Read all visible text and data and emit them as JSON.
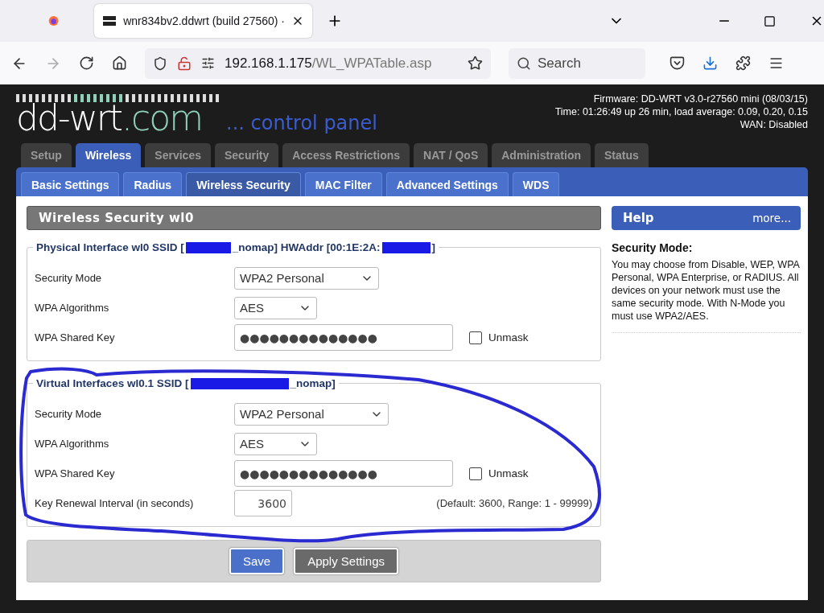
{
  "browser": {
    "tab_title": "wnr834bv2.ddwrt (build 27560) ·",
    "url_host": "192.168.1.175",
    "url_path": "/WL_WPATable.asp",
    "search_placeholder": "Search"
  },
  "header": {
    "logo": "dd-wrt",
    "logo_suffix": ".com",
    "tagline": "... control panel",
    "info": [
      "Firmware: DD-WRT v3.0-r27560 mini (08/03/15)",
      "Time: 01:26:49 up 26 min, load average: 0.09, 0.20, 0.15",
      "WAN: Disabled"
    ]
  },
  "main_tabs": [
    {
      "label": "Setup",
      "selected": false
    },
    {
      "label": "Wireless",
      "selected": true
    },
    {
      "label": "Services",
      "selected": false
    },
    {
      "label": "Security",
      "selected": false
    },
    {
      "label": "Access Restrictions",
      "selected": false
    },
    {
      "label": "NAT / QoS",
      "selected": false
    },
    {
      "label": "Administration",
      "selected": false
    },
    {
      "label": "Status",
      "selected": false
    }
  ],
  "sub_tabs": [
    {
      "label": "Basic Settings",
      "selected": false
    },
    {
      "label": "Radius",
      "selected": false
    },
    {
      "label": "Wireless Security",
      "selected": true
    },
    {
      "label": "MAC Filter",
      "selected": false
    },
    {
      "label": "Advanced Settings",
      "selected": false
    },
    {
      "label": "WDS",
      "selected": false
    }
  ],
  "section_title": "Wireless Security wl0",
  "fieldsets": [
    {
      "legend": [
        {
          "kind": "text",
          "text": "Physical Interface wl0 SSID ["
        },
        {
          "kind": "redacted"
        },
        {
          "kind": "text",
          "text": "_nomap] HWAddr [00:1E:2A:"
        },
        {
          "kind": "redacted"
        },
        {
          "kind": "text",
          "text": "]"
        }
      ],
      "rows": [
        {
          "kind": "select",
          "label": "Security Mode",
          "value": "WPA2 Personal"
        },
        {
          "kind": "select",
          "label": "WPA Algorithms",
          "value": "AES"
        },
        {
          "kind": "password",
          "label": "WPA Shared Key",
          "value": "●●●●●●●●●●●●●●",
          "unmask_label": "Unmask",
          "checked": false
        }
      ]
    },
    {
      "legend": [
        {
          "kind": "text",
          "text": "Virtual Interfaces wl0.1 SSID ["
        },
        {
          "kind": "redacted"
        },
        {
          "kind": "text",
          "text": "_nomap]"
        }
      ],
      "rows": [
        {
          "kind": "select",
          "label": "Security Mode",
          "value": "WPA2 Personal"
        },
        {
          "kind": "select",
          "label": "WPA Algorithms",
          "value": "AES"
        },
        {
          "kind": "password",
          "label": "WPA Shared Key",
          "value": "●●●●●●●●●●●●●●",
          "unmask_label": "Unmask",
          "checked": false
        },
        {
          "kind": "number",
          "label": "Key Renewal Interval (in seconds)",
          "value": "3600",
          "hint": "(Default: 3600, Range: 1 - 99999)"
        }
      ]
    }
  ],
  "buttons": [
    {
      "label": "Save",
      "kind": "primary"
    },
    {
      "label": "Apply Settings",
      "kind": "secondary"
    }
  ],
  "help": {
    "title": "Help",
    "more": "more...",
    "heading": "Security Mode:",
    "body": "You may choose from Disable, WEP, WPA Personal, WPA Enterprise, or RADIUS. All devices on your network must use the same security mode. With N-Mode you must use WPA2/AES."
  }
}
